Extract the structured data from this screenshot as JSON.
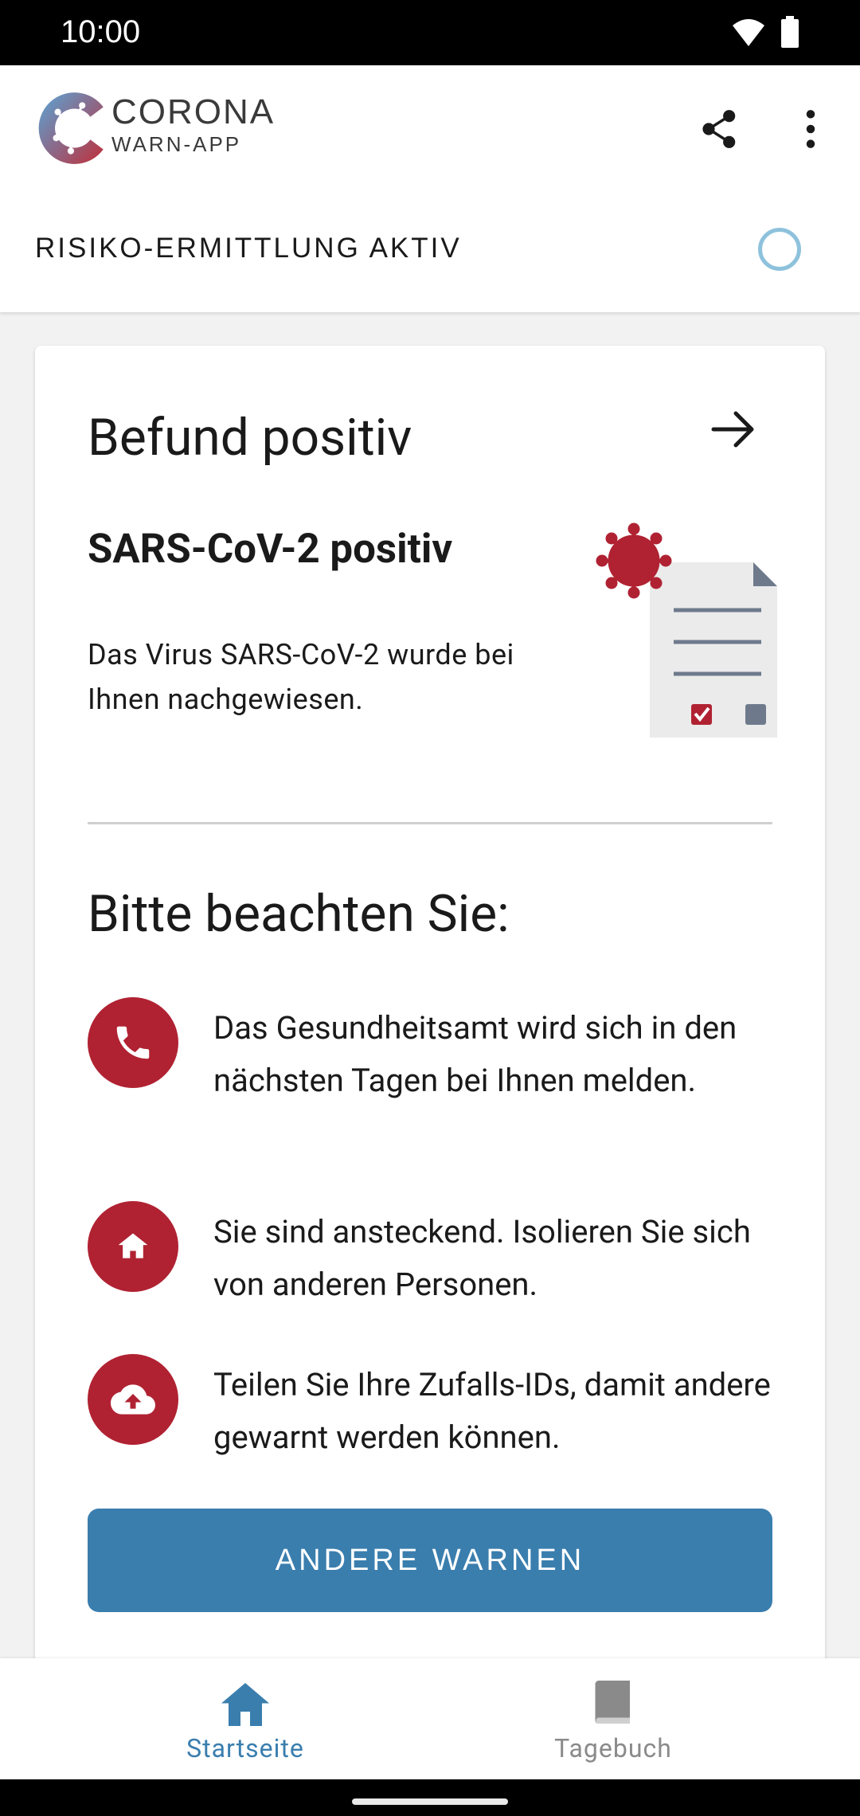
{
  "status_bar": {
    "time": "10:00"
  },
  "app": {
    "logo_line1": "CORONA",
    "logo_line2": "WARN-APP",
    "risk_status": "RISIKO-ERMITTLUNG AKTIV"
  },
  "card": {
    "title": "Befund positiv",
    "result_title": "SARS-CoV-2 positiv",
    "result_text": "Das Virus SARS-CoV-2 wurde bei Ihnen nachgewiesen.",
    "notes_heading": "Bitte beachten Sie:",
    "items": [
      {
        "icon": "phone-icon",
        "text": "Das Gesundheitsamt wird sich in den nächsten Tagen bei Ihnen melden."
      },
      {
        "icon": "home-icon",
        "text": "Sie sind ansteckend. Isolieren Sie sich von anderen Personen."
      },
      {
        "icon": "cloud-upload-icon",
        "text": "Teilen Sie Ihre Zufalls-IDs, damit andere gewarnt werden können."
      }
    ],
    "button_label": "ANDERE WARNEN"
  },
  "bottom_nav": {
    "items": [
      {
        "label": "Startseite",
        "icon": "home-icon",
        "active": true
      },
      {
        "label": "Tagebuch",
        "icon": "book-icon",
        "active": false
      }
    ]
  },
  "colors": {
    "accent_blue": "#3a7eae",
    "alert_red": "#b02232",
    "ring_blue": "#8ec2dc",
    "inactive_gray": "#8a8a8a"
  }
}
